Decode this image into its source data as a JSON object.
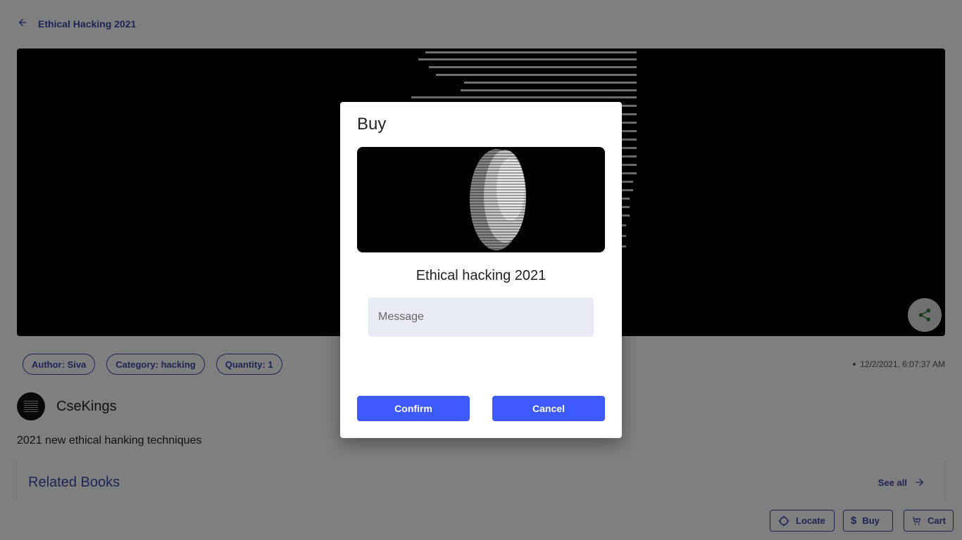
{
  "header": {
    "title": "Ethical Hacking 2021",
    "back_icon": "arrow-left-icon"
  },
  "hero": {
    "share_icon": "share-icon"
  },
  "chips": [
    {
      "label": "Author: Siva"
    },
    {
      "label": "Category: hacking"
    },
    {
      "label": "Quantity: 1"
    }
  ],
  "timestamp": "12/2/2021, 6:07:37 AM",
  "publisher": {
    "name": "CseKings"
  },
  "description": "2021 new ethical hanking techniques",
  "related": {
    "title": "Related Books",
    "see_all": "See all"
  },
  "bottom_bar": {
    "locate": "Locate",
    "buy": "Buy",
    "cart": "Cart"
  },
  "dialog": {
    "title": "Buy",
    "book_title": "Ethical hacking 2021",
    "message_placeholder": "Message",
    "confirm": "Confirm",
    "cancel": "Cancel"
  },
  "colors": {
    "accent": "#3949ab",
    "button": "#3d5afe",
    "scrim": "rgba(0,0,0,0.5)"
  }
}
